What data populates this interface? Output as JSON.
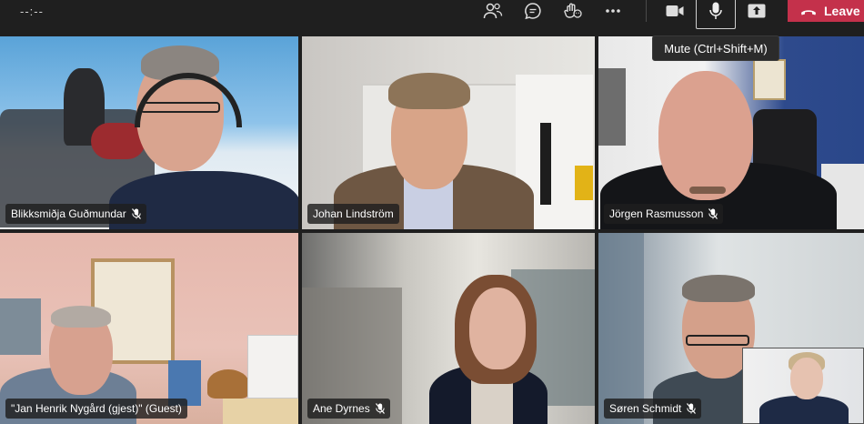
{
  "toolbar": {
    "timer": "--:--",
    "mute_tooltip": "Mute (Ctrl+Shift+M)",
    "leave_label": "Leave",
    "leave_color": "#c4314b"
  },
  "participants": [
    {
      "name": "Blikksmiðja Guðmundar",
      "muted": true
    },
    {
      "name": "Johan Lindström",
      "muted": false
    },
    {
      "name": "Jörgen Rasmusson",
      "muted": true
    },
    {
      "name": "\"Jan Henrik Nygård (gjest)\" (Guest)",
      "muted": false
    },
    {
      "name": "Ane Dyrnes",
      "muted": true
    },
    {
      "name": "Søren Schmidt",
      "muted": true
    }
  ],
  "icons": [
    "people-icon",
    "chat-icon",
    "reactions-icon",
    "more-icon",
    "camera-icon",
    "microphone-icon",
    "share-icon",
    "phone-hangup-icon",
    "mic-off-icon"
  ]
}
